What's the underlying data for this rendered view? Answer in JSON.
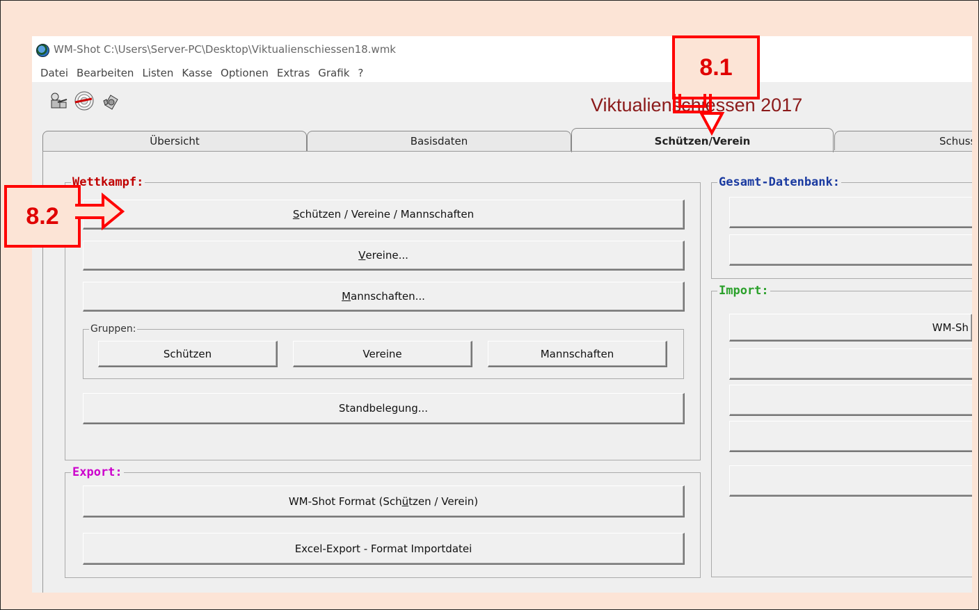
{
  "window": {
    "title": "WM-Shot C:\\Users\\Server-PC\\Desktop\\Viktualienschiessen18.wmk",
    "menu": [
      "Datei",
      "Bearbeiten",
      "Listen",
      "Kasse",
      "Optionen",
      "Extras",
      "Grafik",
      "?"
    ]
  },
  "toolbar": {
    "icons": [
      "shooter-icon",
      "target-icon",
      "gear-icon"
    ]
  },
  "app_title": "Viktualienschiessen 2017",
  "tabs": [
    "Übersicht",
    "Basisdaten",
    "Schützen/Verein",
    "Schuss"
  ],
  "active_tab": "Schützen/Verein",
  "wettkampf": {
    "label": "Wettkampf:",
    "color": "#c00000",
    "btn_schuetzen_a": "S",
    "btn_schuetzen_b": "chützen / Vereine / Mannschaften",
    "btn_vereine_a": "V",
    "btn_vereine_b": "ereine...",
    "btn_mann_a": "M",
    "btn_mann_b": "annschaften...",
    "gruppen": {
      "label": "Gruppen:",
      "schuetzen": "Schützen",
      "vereine": "Vereine",
      "mannschaften": "Mannschaften"
    },
    "btn_stand": "Standbelegung..."
  },
  "export": {
    "label": "Export:",
    "color": "#cc00cc",
    "btn_wmshot_a": "WM-Shot Format (Sch",
    "btn_wmshot_u": "ü",
    "btn_wmshot_b": "tzen / Verein)",
    "btn_excel": "Excel-Export - Format Importdatei"
  },
  "gesamt": {
    "label": "Gesamt-Datenbank:",
    "color": "#1a3aa0"
  },
  "import": {
    "label": "Import:",
    "color": "#2aa02a",
    "btn_wmsh": "WM-Sh"
  },
  "callouts": {
    "c81": "8.1",
    "c82": "8.2"
  }
}
